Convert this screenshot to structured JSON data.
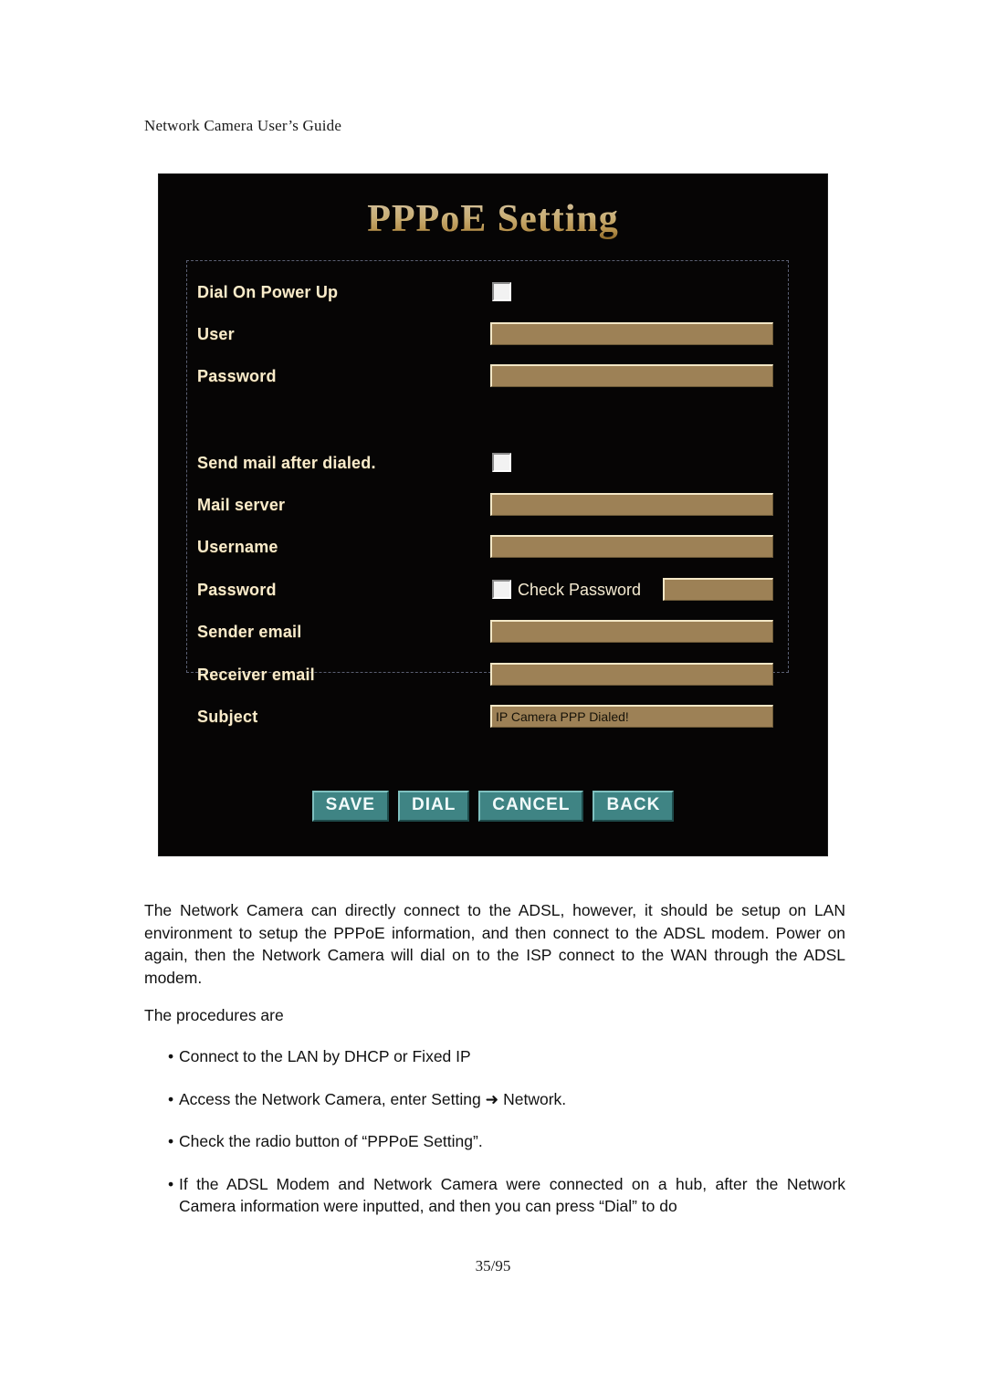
{
  "document": {
    "header": "Network Camera User’s Guide",
    "page_number": "35/95"
  },
  "screenshot_panel": {
    "title": "PPPoE Setting",
    "colors": {
      "panel_background": "#060505",
      "title_gold": "#f5e2ab",
      "label_cream": "#faeccb",
      "input_fill": "#9d8156",
      "input_highlight": "#f3e7c6",
      "button_teal": "#3f8484",
      "dashed_border": "#5a5f72"
    },
    "fields": [
      {
        "label": "Dial On Power Up",
        "control": "checkbox",
        "checked": false,
        "value": ""
      },
      {
        "label": "User",
        "control": "text",
        "value": ""
      },
      {
        "label": "Password",
        "control": "text",
        "value": ""
      },
      {
        "label": "Send mail after dialed.",
        "control": "checkbox",
        "checked": false,
        "value": ""
      },
      {
        "label": "Mail server",
        "control": "text",
        "value": ""
      },
      {
        "label": "Username",
        "control": "text",
        "value": ""
      },
      {
        "label": "Password",
        "control": "checkbox-with-text",
        "inline_label": "Check Password",
        "checked": false,
        "value": ""
      },
      {
        "label": "Sender email",
        "control": "text",
        "value": ""
      },
      {
        "label": "Receiver email",
        "control": "text",
        "value": ""
      },
      {
        "label": "Subject",
        "control": "text",
        "value": "IP Camera PPP Dialed!"
      }
    ],
    "buttons": [
      {
        "label": "SAVE"
      },
      {
        "label": "DIAL"
      },
      {
        "label": "CANCEL"
      },
      {
        "label": "BACK"
      }
    ]
  },
  "body": {
    "paragraph": "The Network Camera can directly connect to the ADSL, however, it should be setup on LAN environment to setup the PPPoE information, and then connect to the ADSL modem. Power on again, then the Network Camera will dial on to the ISP connect to the WAN through the ADSL modem.",
    "intro": "The procedures are",
    "bullet_char": "•",
    "bullets": [
      "Connect to the LAN by DHCP or Fixed IP",
      "Access the Network Camera, enter Setting ➜ Network.",
      "Check the radio button of “PPPoE Setting”.",
      "If the ADSL Modem and Network Camera were connected on a hub, after the Network Camera information were inputted, and then you can press “Dial” to do"
    ]
  }
}
